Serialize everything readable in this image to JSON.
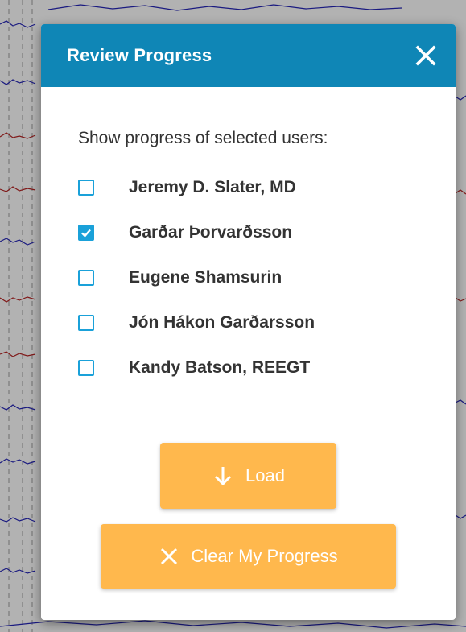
{
  "dialog": {
    "title": "Review Progress",
    "close_icon": "close-icon"
  },
  "users_section": {
    "label": "Show progress of selected users:",
    "users": [
      {
        "name": "Jeremy D. Slater, MD",
        "checked": false
      },
      {
        "name": "Garðar Þorvarðsson",
        "checked": true
      },
      {
        "name": "Eugene Shamsurin",
        "checked": false
      },
      {
        "name": "Jón Hákon Garðarsson",
        "checked": false
      },
      {
        "name": "Kandy Batson, REEGT",
        "checked": false
      }
    ]
  },
  "buttons": {
    "load_label": "Load",
    "load_icon": "arrow-down-icon",
    "clear_label": "Clear My Progress",
    "clear_icon": "x-icon"
  },
  "colors": {
    "header": "#0f86b6",
    "checkbox": "#1aa1d9",
    "button": "#ffb84d"
  }
}
